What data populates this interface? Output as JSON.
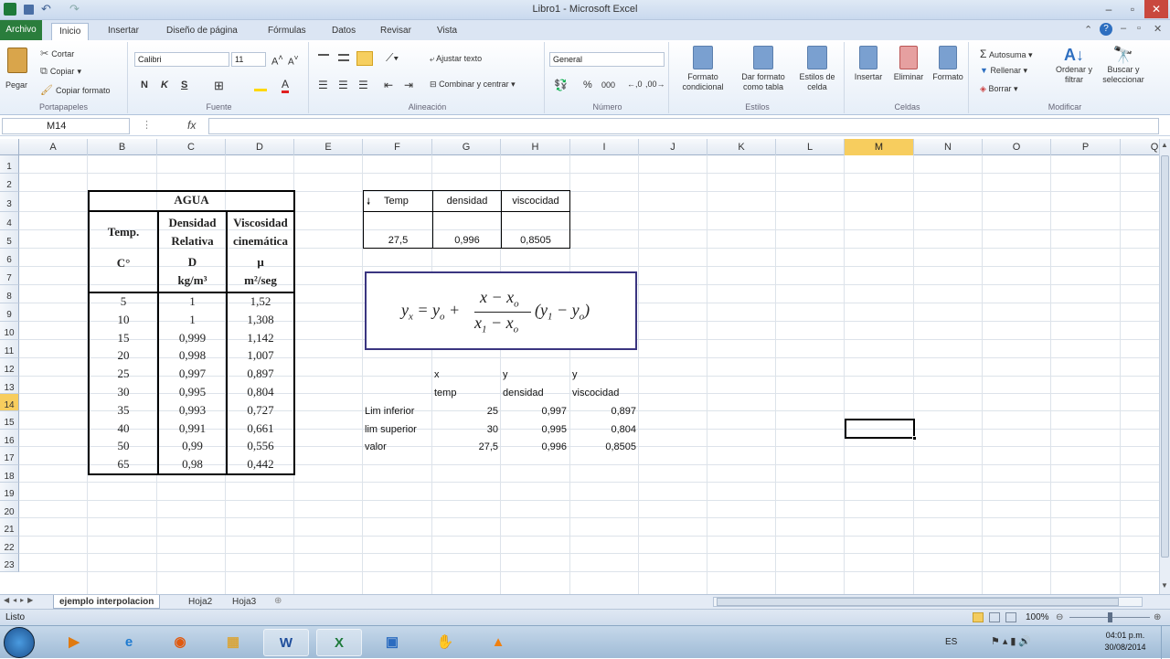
{
  "window": {
    "title": "Libro1 - Microsoft Excel"
  },
  "tabs": {
    "file": "Archivo",
    "items": [
      "Inicio",
      "Insertar",
      "Diseño de página",
      "Fórmulas",
      "Datos",
      "Revisar",
      "Vista"
    ]
  },
  "ribbon": {
    "clipboard": {
      "paste": "Pegar",
      "cut": "Cortar",
      "copy": "Copiar",
      "format_painter": "Copiar formato",
      "label": "Portapapeles"
    },
    "font": {
      "name": "Calibri",
      "size": "11",
      "bold": "N",
      "italic": "K",
      "underline": "S",
      "label": "Fuente"
    },
    "alignment": {
      "wrap": "Ajustar texto",
      "merge": "Combinar y centrar",
      "label": "Alineación"
    },
    "number": {
      "format": "General",
      "percent": "%",
      "thousands": "000",
      "label": "Número"
    },
    "styles": {
      "conditional": "Formato condicional",
      "as_table": "Dar formato como tabla",
      "cell_styles": "Estilos de celda",
      "label": "Estilos"
    },
    "cells": {
      "insert": "Insertar",
      "delete": "Eliminar",
      "format": "Formato",
      "label": "Celdas"
    },
    "editing": {
      "autosum": "Autosuma",
      "fill": "Rellenar",
      "clear": "Borrar",
      "sort": "Ordenar y filtrar",
      "find": "Buscar y seleccionar",
      "label": "Modificar"
    }
  },
  "formula_bar": {
    "name_box": "M14",
    "fx": "fx",
    "value": ""
  },
  "columns": [
    "A",
    "B",
    "C",
    "D",
    "E",
    "F",
    "G",
    "H",
    "I",
    "J",
    "K",
    "L",
    "M",
    "N",
    "O",
    "P",
    "Q"
  ],
  "rows": [
    "1",
    "2",
    "3",
    "4",
    "5",
    "6",
    "7",
    "8",
    "9",
    "10",
    "11",
    "12",
    "13",
    "14",
    "15",
    "16",
    "17",
    "18",
    "19",
    "20",
    "21",
    "22",
    "23"
  ],
  "selected": {
    "col": "M",
    "row": "14"
  },
  "water_table": {
    "title": "AGUA",
    "h1": "Temp.",
    "h1_unit": "C°",
    "h2a": "Densidad",
    "h2b": "Relativa",
    "h2_sym": "D",
    "h2_unit": "kg/m³",
    "h3a": "Viscosidad",
    "h3b": "cinemática",
    "h3_sym": "μ",
    "h3_unit": "m²/seg",
    "data": [
      [
        "5",
        "1",
        "1,52"
      ],
      [
        "10",
        "1",
        "1,308"
      ],
      [
        "15",
        "0,999",
        "1,142"
      ],
      [
        "20",
        "0,998",
        "1,007"
      ],
      [
        "25",
        "0,997",
        "0,897"
      ],
      [
        "30",
        "0,995",
        "0,804"
      ],
      [
        "35",
        "0,993",
        "0,727"
      ],
      [
        "40",
        "0,991",
        "0,661"
      ],
      [
        "50",
        "0,99",
        "0,556"
      ],
      [
        "65",
        "0,98",
        "0,442"
      ]
    ]
  },
  "lookup": {
    "headers": [
      "Temp",
      "densidad",
      "viscocidad"
    ],
    "values": [
      "27,5",
      "0,996",
      "0,8505"
    ]
  },
  "interp": {
    "vars": [
      "x",
      "y",
      "y"
    ],
    "names": [
      "temp",
      "densidad",
      "viscocidad"
    ],
    "rows": [
      {
        "label": "Lim inferior",
        "vals": [
          "25",
          "0,997",
          "0,897"
        ]
      },
      {
        "label": "lim superior",
        "vals": [
          "30",
          "0,995",
          "0,804"
        ]
      },
      {
        "label": "valor",
        "vals": [
          "27,5",
          "0,996",
          "0,8505"
        ]
      }
    ]
  },
  "sheets": [
    "ejemplo interpolacion",
    "Hoja2",
    "Hoja3"
  ],
  "status": {
    "ready": "Listo",
    "zoom": "100%"
  },
  "taskbar": {
    "lang": "ES",
    "time": "04:01 p.m.",
    "date": "30/08/2014"
  }
}
